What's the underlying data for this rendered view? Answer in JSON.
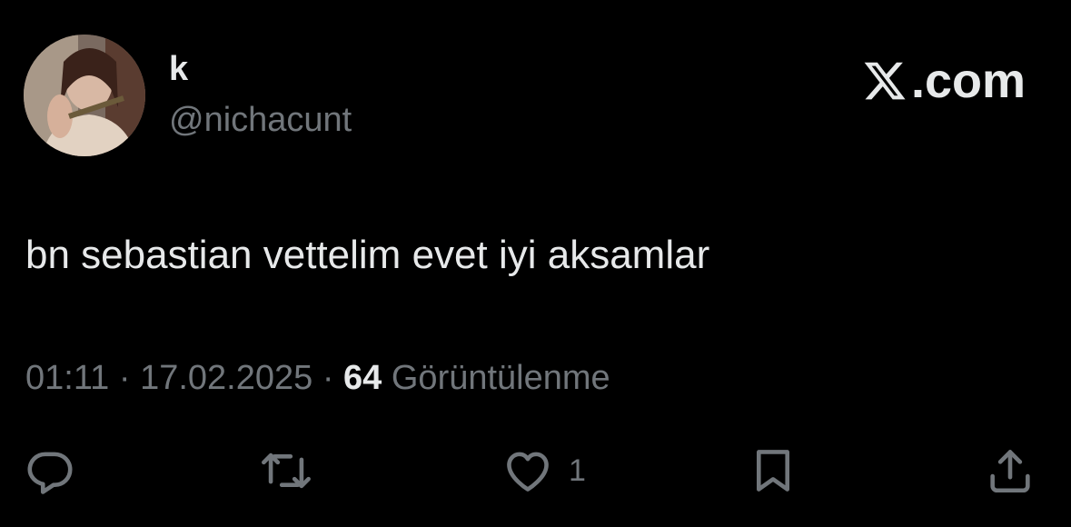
{
  "author": {
    "display_name": "k",
    "handle": "@nichacunt",
    "avatar_icon": "profile-photo"
  },
  "brand": {
    "logo_icon": "x-logo-icon",
    "label": ".com"
  },
  "tweet": {
    "text": "bn sebastian vettelim evet iyi aksamlar",
    "time": "01:11",
    "separator": "·",
    "date": "17.02.2025",
    "views_count": "64",
    "views_label": "Görüntülenme"
  },
  "actions": {
    "reply": {
      "icon": "reply-icon"
    },
    "retweet": {
      "icon": "retweet-icon"
    },
    "like": {
      "icon": "heart-icon",
      "count": "1"
    },
    "bookmark": {
      "icon": "bookmark-icon"
    },
    "share": {
      "icon": "share-icon"
    }
  },
  "colors": {
    "background": "#000000",
    "primary_text": "#e7e9ea",
    "secondary_text": "#71767b"
  }
}
